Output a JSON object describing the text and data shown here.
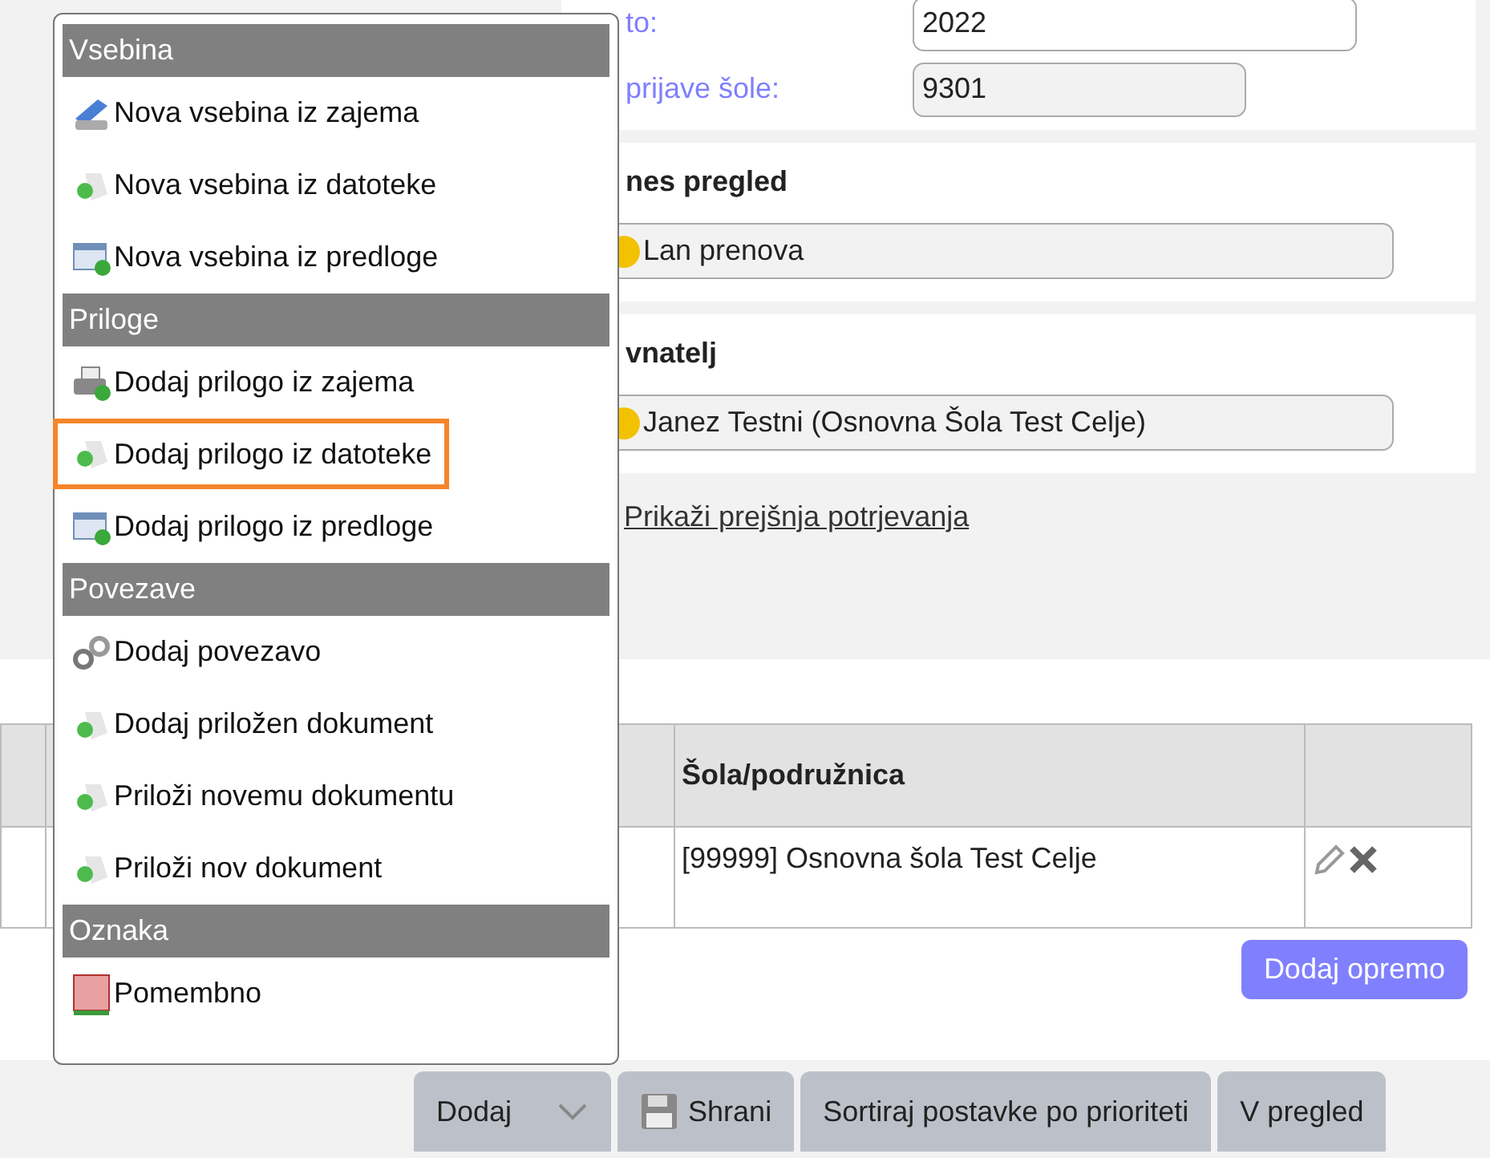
{
  "form": {
    "fields": [
      {
        "label": "to:",
        "value": "2022",
        "disabled": false
      },
      {
        "label": "prijave šole:",
        "value": "9301",
        "disabled": true
      }
    ]
  },
  "sections": [
    {
      "heading": "nes pregled",
      "value": "Lan prenova",
      "color": "#f2c200"
    },
    {
      "heading": "vnatelj",
      "value": "Janez Testni (Osnovna Šola Test Celje)",
      "color": "#f2c200"
    }
  ],
  "history_link": "Prikaži prejšnja potrjevanja",
  "table": {
    "columns": [
      "Šola/podružnica"
    ],
    "rows": [
      {
        "cells": [
          "[99999] Osnovna šola Test Celje"
        ]
      }
    ]
  },
  "add_equipment_button": "Dodaj opremo",
  "menu": {
    "groups": [
      {
        "title": "Vsebina",
        "items": [
          {
            "label": "Nova vsebina iz zajema",
            "kind": "scanner",
            "highlighted": false
          },
          {
            "label": "Nova vsebina iz datoteke",
            "kind": "file",
            "highlighted": false
          },
          {
            "label": "Nova vsebina iz predloge",
            "kind": "template",
            "highlighted": false
          }
        ]
      },
      {
        "title": "Priloge",
        "items": [
          {
            "label": "Dodaj prilogo iz zajema",
            "kind": "printer",
            "highlighted": false
          },
          {
            "label": "Dodaj prilogo iz datoteke",
            "kind": "file",
            "highlighted": true
          },
          {
            "label": "Dodaj prilogo iz predloge",
            "kind": "template",
            "highlighted": false
          }
        ]
      },
      {
        "title": "Povezave",
        "items": [
          {
            "label": "Dodaj povezavo",
            "kind": "link",
            "highlighted": false
          },
          {
            "label": "Dodaj priložen dokument",
            "kind": "file",
            "highlighted": false
          },
          {
            "label": "Priloži novemu dokumentu",
            "kind": "file",
            "highlighted": false
          },
          {
            "label": "Priloži nov dokument",
            "kind": "file",
            "highlighted": false
          }
        ]
      },
      {
        "title": "Oznaka",
        "items": [
          {
            "label": "Pomembno",
            "kind": "flag",
            "highlighted": false
          }
        ]
      }
    ]
  },
  "toolbar": [
    {
      "label": "Dodaj",
      "kind": "dropdown"
    },
    {
      "label": "Shrani",
      "kind": "save"
    },
    {
      "label": "Sortiraj postavke po prioriteti",
      "kind": "plain"
    },
    {
      "label": "V pregled",
      "kind": "plain"
    }
  ]
}
